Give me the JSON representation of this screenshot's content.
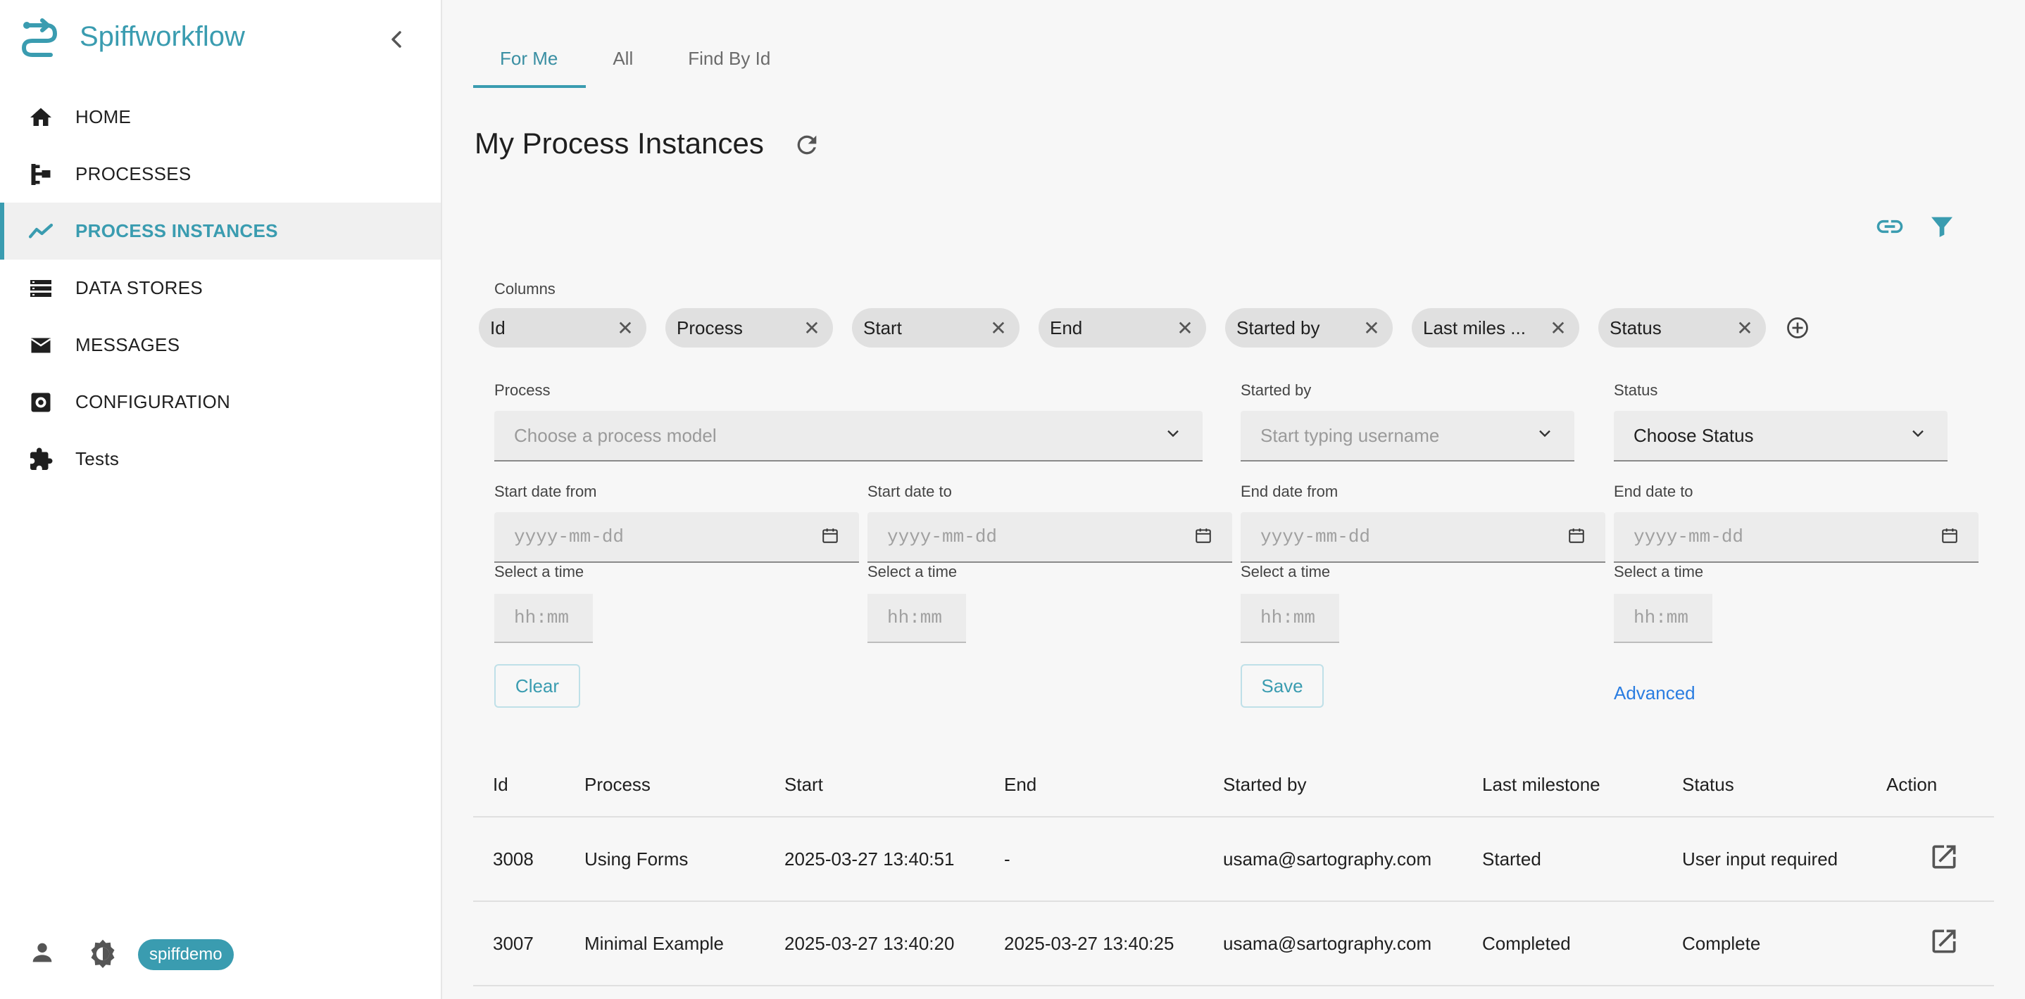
{
  "app": {
    "brand": "Spiffworkflow",
    "user_badge": "spiffdemo"
  },
  "colors": {
    "accent": "#3a9cb0",
    "link": "#2a7de1"
  },
  "sidebar": {
    "items": [
      {
        "label": "HOME",
        "icon": "home-icon",
        "active": false
      },
      {
        "label": "PROCESSES",
        "icon": "process-tree-icon",
        "active": false
      },
      {
        "label": "PROCESS INSTANCES",
        "icon": "trend-line-icon",
        "active": true
      },
      {
        "label": "DATA STORES",
        "icon": "storage-list-icon",
        "active": false
      },
      {
        "label": "MESSAGES",
        "icon": "envelope-icon",
        "active": false
      },
      {
        "label": "CONFIGURATION",
        "icon": "settings-cog-icon",
        "active": false
      },
      {
        "label": "Tests",
        "icon": "puzzle-icon",
        "active": false
      }
    ]
  },
  "tabs": [
    "For Me",
    "All",
    "Find By Id"
  ],
  "page": {
    "title": "My Process Instances"
  },
  "columns": {
    "label": "Columns",
    "chips": [
      "Id",
      "Process",
      "Start",
      "End",
      "Started by",
      "Last miles ...",
      "Status"
    ]
  },
  "filters": {
    "process": {
      "label": "Process",
      "placeholder": "Choose a process model"
    },
    "started_by": {
      "label": "Started by",
      "placeholder": "Start typing username"
    },
    "status": {
      "label": "Status",
      "value": "Choose Status"
    },
    "start_from": {
      "label": "Start date from",
      "placeholder": "yyyy-mm-dd",
      "time_label": "Select a time",
      "time_placeholder": "hh:mm"
    },
    "start_to": {
      "label": "Start date to",
      "placeholder": "yyyy-mm-dd",
      "time_label": "Select a time",
      "time_placeholder": "hh:mm"
    },
    "end_from": {
      "label": "End date from",
      "placeholder": "yyyy-mm-dd",
      "time_label": "Select a time",
      "time_placeholder": "hh:mm"
    },
    "end_to": {
      "label": "End date to",
      "placeholder": "yyyy-mm-dd",
      "time_label": "Select a time",
      "time_placeholder": "hh:mm"
    },
    "clear": "Clear",
    "save": "Save",
    "advanced": "Advanced"
  },
  "table": {
    "headers": [
      "Id",
      "Process",
      "Start",
      "End",
      "Started by",
      "Last milestone",
      "Status",
      "Action"
    ],
    "rows": [
      {
        "id": "3008",
        "process": "Using Forms",
        "start": "2025-03-27 13:40:51",
        "end": "-",
        "started_by": "usama@sartography.com",
        "milestone": "Started",
        "status": "User input required"
      },
      {
        "id": "3007",
        "process": "Minimal Example",
        "start": "2025-03-27 13:40:20",
        "end": "2025-03-27 13:40:25",
        "started_by": "usama@sartography.com",
        "milestone": "Completed",
        "status": "Complete"
      }
    ]
  }
}
